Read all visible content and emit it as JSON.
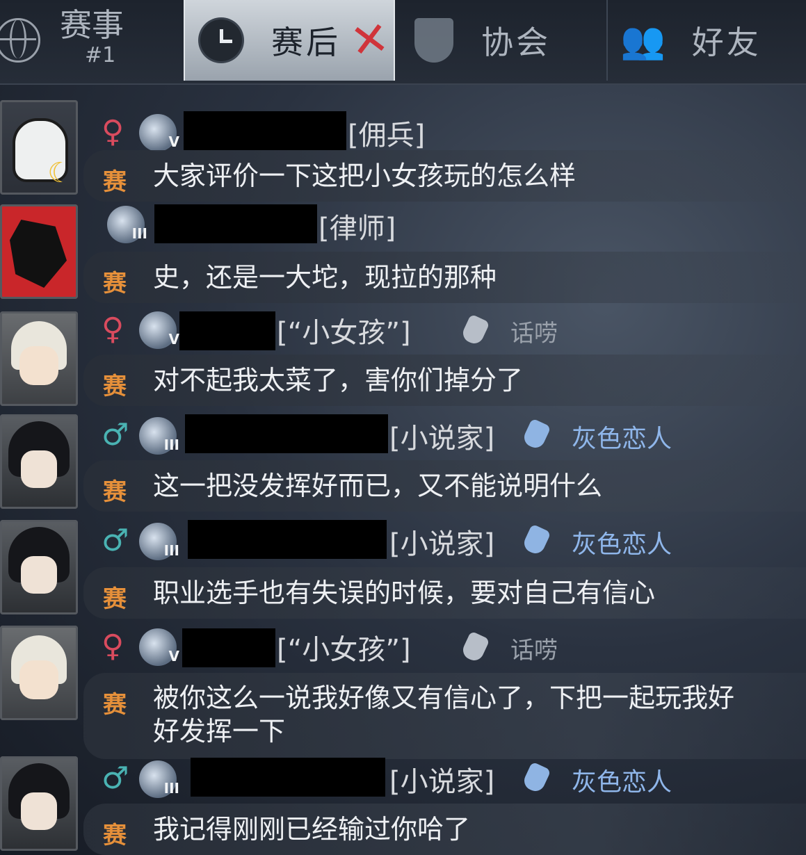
{
  "tabs": [
    {
      "label": "赛事",
      "sub": "#1",
      "icon": "globe-icon"
    },
    {
      "label": "赛后",
      "icon": "clock-icon",
      "active": true
    },
    {
      "label": "协会",
      "icon": "shield-fist-icon"
    },
    {
      "label": "好友",
      "icon": "people-icon"
    }
  ],
  "channel_tag": "赛",
  "messages": [
    {
      "gender": "♀",
      "role": "[佣兵]",
      "title": "",
      "text": "大家评价一下这把小女孩玩的怎么样",
      "rank": "V"
    },
    {
      "gender": "",
      "role": "[律师]",
      "title": "",
      "text": "史，还是一大坨，现拉的那种",
      "rank": "III"
    },
    {
      "gender": "♀",
      "role": "[“小女孩”]",
      "title": "话唠",
      "text": "对不起我太菜了，害你们掉分了",
      "rank": "V"
    },
    {
      "gender": "♂",
      "role": "[小说家]",
      "title": "灰色恋人",
      "text": "这一把没发挥好而已，又不能说明什么",
      "rank": "III"
    },
    {
      "gender": "♂",
      "role": "[小说家]",
      "title": "灰色恋人",
      "text": "职业选手也有失误的时候，要对自己有信心",
      "rank": "III"
    },
    {
      "gender": "♀",
      "role": "[“小女孩”]",
      "title": "话唠",
      "text": "被你这么一说我好像又有信心了，下把一起玩我好",
      "text2": "好发挥一下",
      "rank": "V"
    },
    {
      "gender": "♂",
      "role": "[小说家]",
      "title": "灰色恋人",
      "text": "我记得刚刚已经输过你哈了",
      "rank": "III"
    }
  ],
  "colors": {
    "female": "#d94b5e",
    "male": "#4ab3b3",
    "channel_tag": "#e6903a",
    "title_blue": "#8fb6ea",
    "close_x": "#d0343a"
  }
}
